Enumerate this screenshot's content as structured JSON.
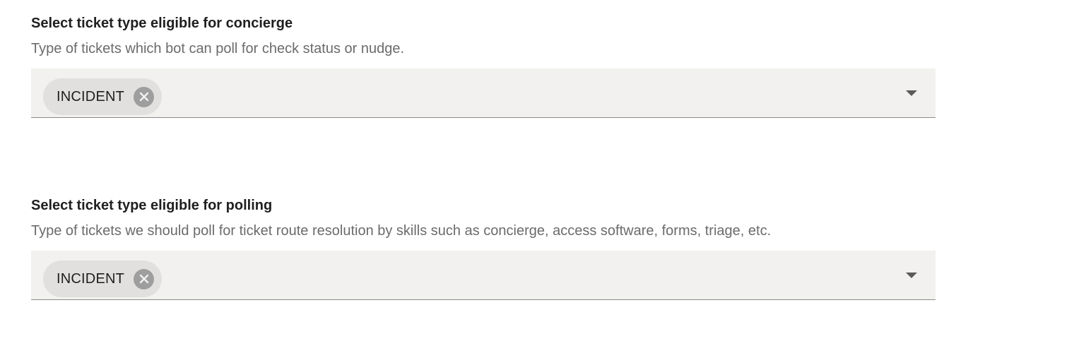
{
  "concierge": {
    "title": "Select ticket type eligible for concierge",
    "description": "Type of tickets which bot can poll for check status or nudge.",
    "selected": [
      {
        "label": "INCIDENT",
        "remove_icon": "close-circle-icon"
      }
    ],
    "dropdown_icon": "caret-down-icon"
  },
  "polling": {
    "title": "Select ticket type eligible for polling",
    "description": "Type of tickets we should poll for ticket route resolution by skills such as concierge, access software, forms, triage, etc.",
    "selected": [
      {
        "label": "INCIDENT",
        "remove_icon": "close-circle-icon"
      }
    ],
    "dropdown_icon": "caret-down-icon"
  },
  "colors": {
    "field_background": "#f2f1ef",
    "chip_background": "#e1e0de",
    "chip_remove": "#9e9e9e",
    "description_text": "#6b6b6b",
    "title_text": "#1f1f1f"
  }
}
